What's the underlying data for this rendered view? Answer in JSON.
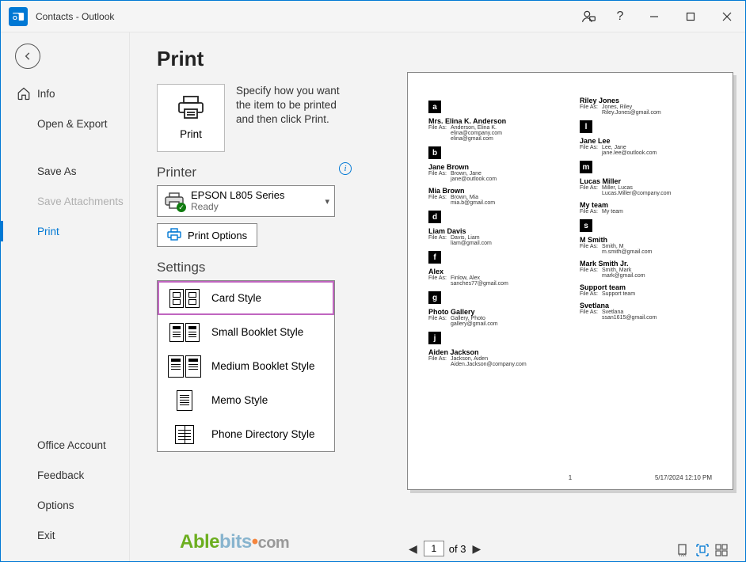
{
  "window_title": "Contacts - Outlook",
  "titlebar": {
    "account_icon_aria": "Account",
    "help_aria": "Help"
  },
  "sidebar": {
    "info": "Info",
    "open_export": "Open & Export",
    "save_as": "Save As",
    "save_attachments": "Save Attachments",
    "print": "Print",
    "office_account": "Office Account",
    "feedback": "Feedback",
    "options": "Options",
    "exit": "Exit"
  },
  "main": {
    "header": "Print",
    "print_btn": "Print",
    "print_desc": "Specify how you want the item to be printed and then click Print.",
    "printer_section": "Printer",
    "printer_name": "EPSON L805 Series",
    "printer_status": "Ready",
    "print_options_btn": "Print Options",
    "settings_section": "Settings",
    "styles": [
      "Card Style",
      "Small Booklet Style",
      "Medium Booklet Style",
      "Memo Style",
      "Phone Directory Style"
    ]
  },
  "preview": {
    "page_number": "1",
    "page_footer_date": "5/17/2024 12:10 PM",
    "left_col": [
      {
        "type": "letter",
        "label": "a"
      },
      {
        "type": "contact",
        "name": "Mrs. Elina K. Anderson",
        "lines": [
          [
            "File As:",
            "Anderson, Elina K."
          ],
          [
            "",
            "elina@company.com"
          ],
          [
            "",
            "elina@gmail.com"
          ]
        ]
      },
      {
        "type": "letter",
        "label": "b"
      },
      {
        "type": "contact",
        "name": "Jane Brown",
        "lines": [
          [
            "File As:",
            "Brown, Jane"
          ],
          [
            "",
            "jane@outlook.com"
          ]
        ]
      },
      {
        "type": "contact",
        "name": "Mia Brown",
        "lines": [
          [
            "File As:",
            "Brown, Mia"
          ],
          [
            "",
            "mia.b@gmail.com"
          ]
        ]
      },
      {
        "type": "letter",
        "label": "d"
      },
      {
        "type": "contact",
        "name": "Liam Davis",
        "lines": [
          [
            "File As:",
            "Davis, Liam"
          ],
          [
            "",
            "liam@gmail.com"
          ]
        ]
      },
      {
        "type": "letter",
        "label": "f"
      },
      {
        "type": "contact",
        "name": "Alex",
        "lines": [
          [
            "File As:",
            "Finlow, Alex"
          ],
          [
            "",
            "sanches77@gmail.com"
          ]
        ]
      },
      {
        "type": "letter",
        "label": "g"
      },
      {
        "type": "contact",
        "name": "Photo Gallery",
        "lines": [
          [
            "File As:",
            "Gallery, Photo"
          ],
          [
            "",
            "gallery@gmail.com"
          ]
        ]
      },
      {
        "type": "letter",
        "label": "j"
      },
      {
        "type": "contact",
        "name": "Aiden Jackson",
        "lines": [
          [
            "File As:",
            "Jackson, Aiden"
          ],
          [
            "",
            "Aiden.Jackson@company.com"
          ]
        ]
      }
    ],
    "right_col": [
      {
        "type": "contact",
        "name": "Riley Jones",
        "lines": [
          [
            "File As:",
            "Jones, Riley"
          ],
          [
            "",
            "Riley.Jones@gmail.com"
          ]
        ]
      },
      {
        "type": "letter",
        "label": "l"
      },
      {
        "type": "contact",
        "name": "Jane Lee",
        "lines": [
          [
            "File As:",
            "Lee, Jane"
          ],
          [
            "",
            "jane.lee@outlook.com"
          ]
        ]
      },
      {
        "type": "letter",
        "label": "m"
      },
      {
        "type": "contact",
        "name": "Lucas Miller",
        "lines": [
          [
            "File As:",
            "Miller, Lucas"
          ],
          [
            "",
            "Lucas.Miller@company.com"
          ]
        ]
      },
      {
        "type": "contact",
        "name": "My team",
        "lines": [
          [
            "File As:",
            "My team"
          ]
        ]
      },
      {
        "type": "letter",
        "label": "s"
      },
      {
        "type": "contact",
        "name": "M Smith",
        "lines": [
          [
            "File As:",
            "Smith, M"
          ],
          [
            "",
            "m.smith@gmail.com"
          ]
        ]
      },
      {
        "type": "contact",
        "name": "Mark Smith Jr.",
        "lines": [
          [
            "File As:",
            "Smith, Mark"
          ],
          [
            "",
            "mark@gmail.com"
          ]
        ]
      },
      {
        "type": "contact",
        "name": "Support team",
        "lines": [
          [
            "File As:",
            "Support team"
          ]
        ]
      },
      {
        "type": "contact",
        "name": "Svetlana",
        "lines": [
          [
            "File As:",
            "Svetlana"
          ],
          [
            "",
            "ssan1615@gmail.com"
          ]
        ]
      }
    ],
    "pager_current": "1",
    "pager_total": "of 3"
  }
}
